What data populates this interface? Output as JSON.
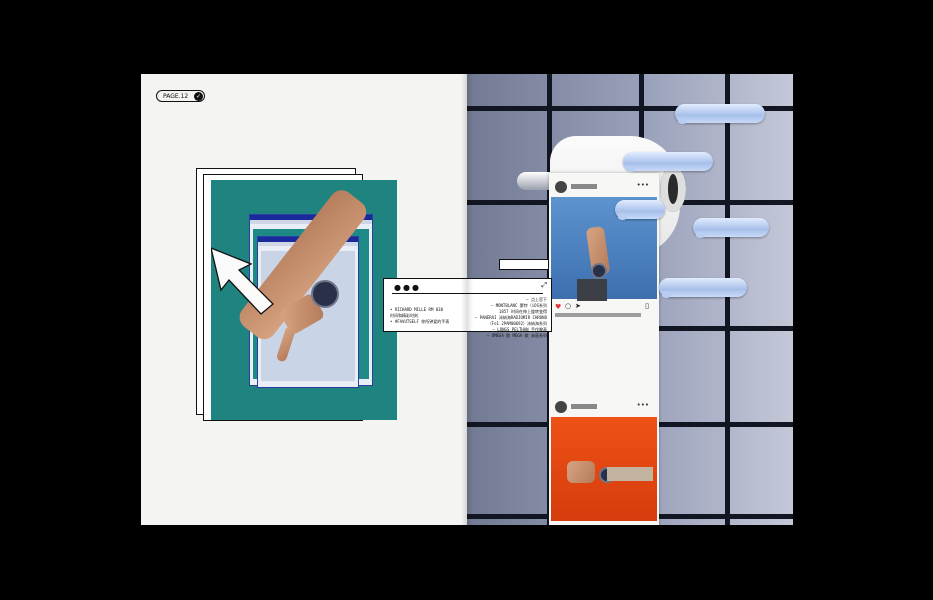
{
  "page_label": "PAGE.12",
  "popup": {
    "left_lines": [
      "• RICHARD MILLE RM 030",
      "时间和精彩时刻",
      "• #FAVUTSELF 你所钟爱的手表"
    ],
    "right_lines": [
      "— 点上官下",
      "— MONTBLANC 蒙特（iOS系列",
      "1857 时间在伸上旋转变得",
      "— PANERAI 沛纳海RADIOMIR CHRONO",
      "（Fo1 2PAM00692）沛纳海系列",
      "— LONGS PELTHAN 手作腕表",
      "— OMEGA 欧 MEGA 欧 米茄系列"
    ]
  },
  "colors": {
    "dark": "#111111",
    "teal": "#1f8380",
    "tile": "#121522",
    "bubble": "#a7c0ea",
    "photo_blue": "#4f85c4",
    "photo_orange": "#e14512",
    "like_red": "#e0353a"
  },
  "icons": [
    "check-icon",
    "cursor-arrow-icon",
    "expand-icon",
    "heart-icon",
    "comment-icon",
    "share-icon",
    "bookmark-icon",
    "more-icon"
  ]
}
